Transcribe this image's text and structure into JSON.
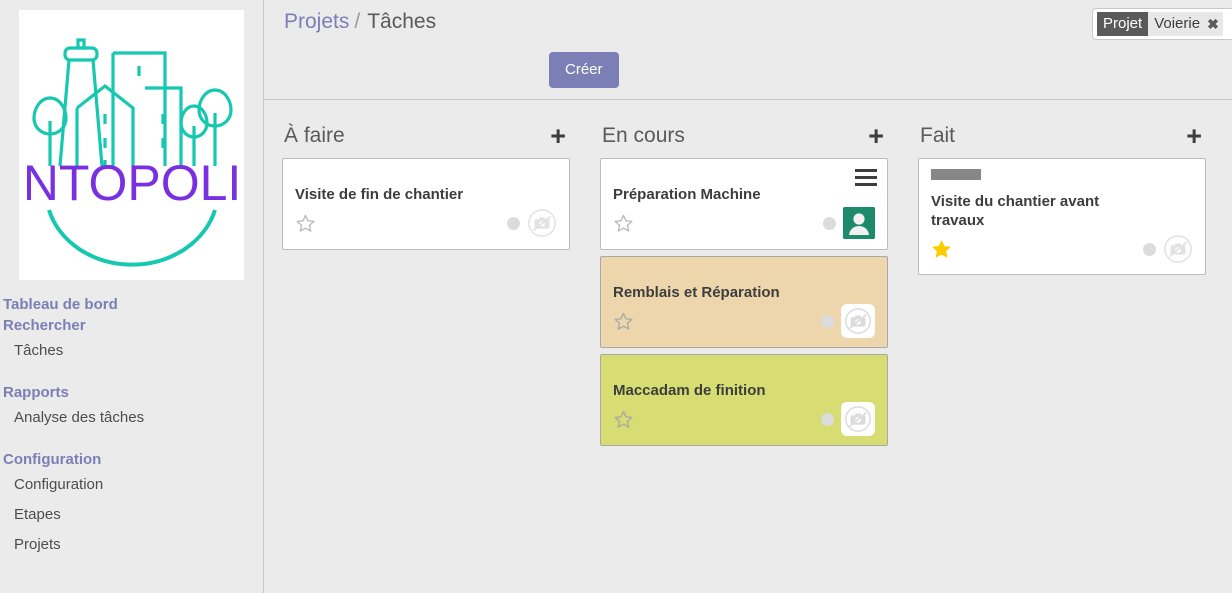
{
  "sidebar": {
    "logo": {
      "brand_text": "ANTOPOLIS",
      "icon": "city-skyline-logo"
    },
    "nav": [
      {
        "type": "head",
        "label": "Tableau de bord",
        "name": "dashboard"
      },
      {
        "type": "head",
        "label": "Rechercher",
        "name": "search"
      },
      {
        "type": "item",
        "label": "Tâches",
        "name": "taches"
      },
      {
        "type": "head",
        "label": "Rapports",
        "name": "rapports"
      },
      {
        "type": "item",
        "label": "Analyse des tâches",
        "name": "analyse-des-taches"
      },
      {
        "type": "head",
        "label": "Configuration",
        "name": "configuration"
      },
      {
        "type": "item",
        "label": "Configuration",
        "name": "configuration-item"
      },
      {
        "type": "item",
        "label": "Etapes",
        "name": "etapes"
      },
      {
        "type": "item",
        "label": "Projets",
        "name": "projets"
      }
    ]
  },
  "header": {
    "breadcrumb": {
      "parent": "Projets",
      "separator": "/",
      "current": "Tâches"
    },
    "create_label": "Créer",
    "filter": {
      "key": "Projet",
      "value": "Voierie",
      "remove_icon": "✖"
    }
  },
  "board": {
    "add_icon": "+",
    "columns": [
      {
        "title": "À faire",
        "name": "a-faire",
        "cards": [
          {
            "title": "Visite de fin de chantier",
            "color": "white",
            "starred": false,
            "star_icon": "star-outline-icon",
            "dot": true,
            "camera": "no-camera-icon",
            "camera_boxed": false,
            "menu": false,
            "avatar": false,
            "label_bar": false
          }
        ]
      },
      {
        "title": "En cours",
        "name": "en-cours",
        "cards": [
          {
            "title": "Préparation Machine",
            "color": "white",
            "starred": false,
            "star_icon": "star-outline-icon",
            "dot": true,
            "camera": null,
            "camera_boxed": false,
            "menu": true,
            "avatar": true,
            "label_bar": false
          },
          {
            "title": "Remblais et Réparation",
            "color": "tan",
            "starred": false,
            "star_icon": "star-outline-icon",
            "dot": true,
            "camera": "no-camera-icon",
            "camera_boxed": true,
            "menu": false,
            "avatar": false,
            "label_bar": false
          },
          {
            "title": "Maccadam de finition",
            "color": "olive",
            "starred": false,
            "star_icon": "star-outline-icon",
            "dot": true,
            "camera": "no-camera-icon",
            "camera_boxed": true,
            "menu": false,
            "avatar": false,
            "label_bar": false
          }
        ]
      },
      {
        "title": "Fait",
        "name": "fait",
        "cards": [
          {
            "title": "Visite du chantier avant travaux",
            "color": "white",
            "starred": true,
            "star_icon": "star-filled-icon",
            "dot": true,
            "camera": "no-camera-icon",
            "camera_boxed": false,
            "menu": false,
            "avatar": false,
            "label_bar": true
          }
        ]
      }
    ]
  },
  "colors": {
    "accent": "#7b7fb5",
    "page_bg": "#ebebeb",
    "card_tan": "#eed6ac",
    "card_olive": "#d7dd72",
    "avatar_green": "#1d8a6b",
    "star_gold": "#ffcc00",
    "logo_teal": "#16c8b0",
    "logo_purple": "#7a2fe0"
  }
}
